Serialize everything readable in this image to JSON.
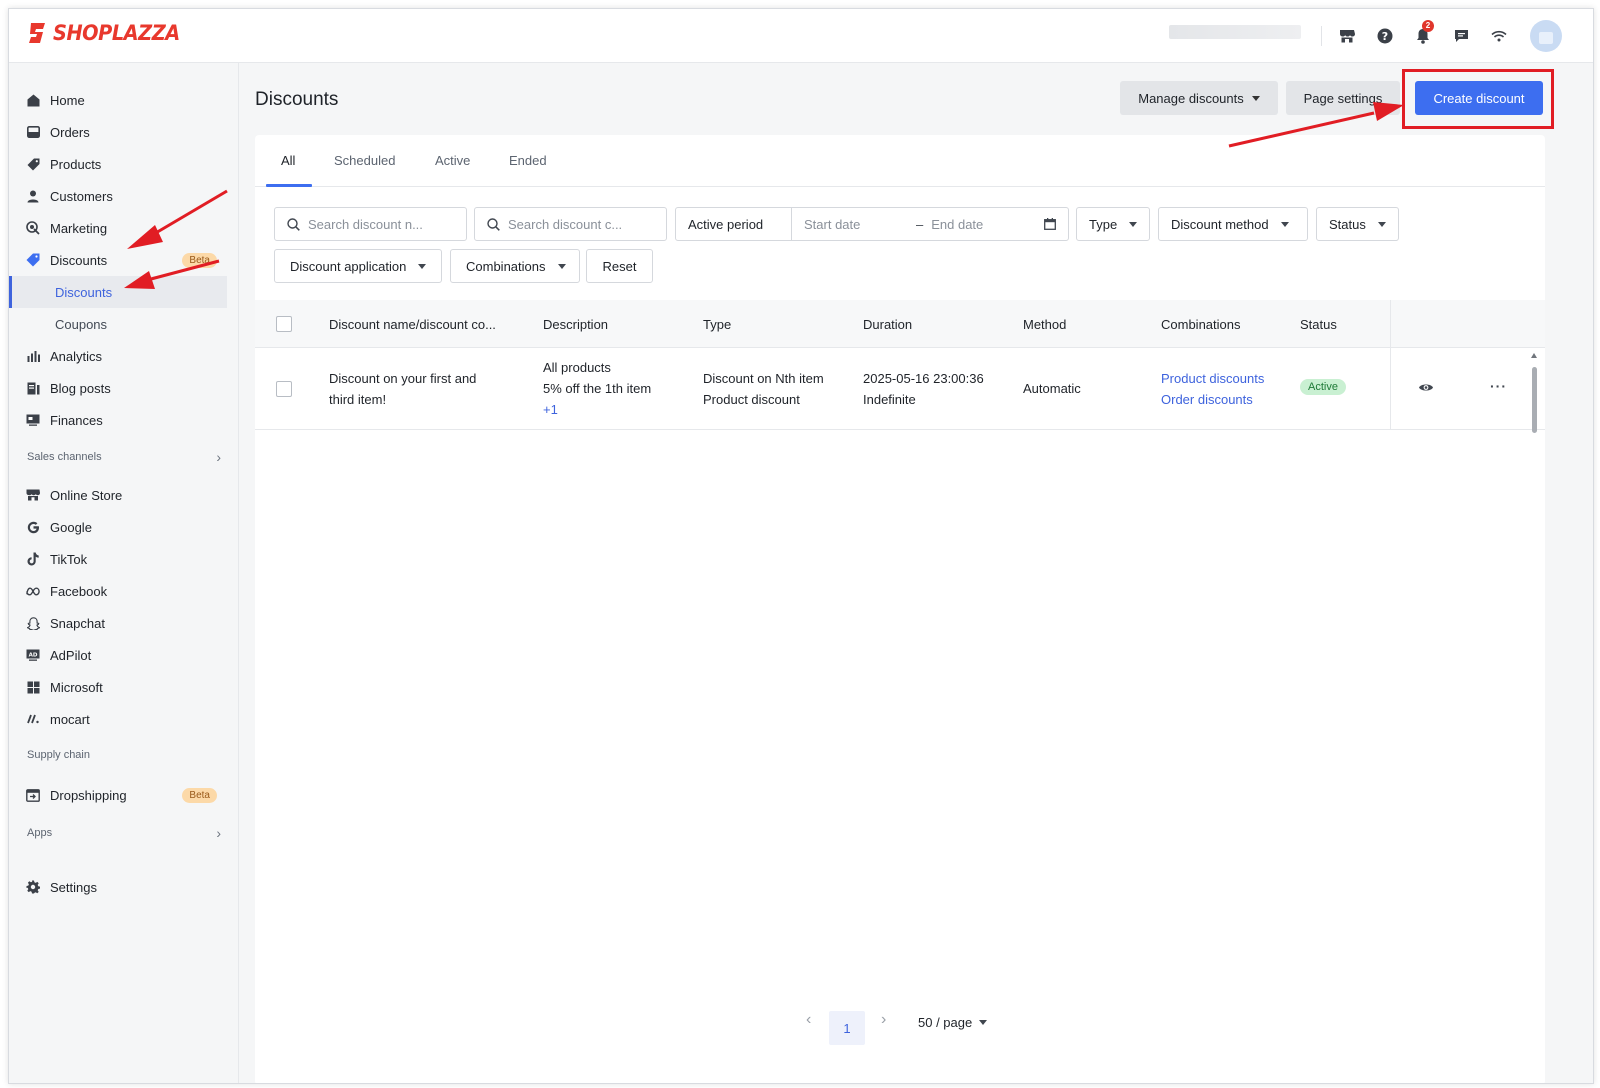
{
  "brand": {
    "name": "SHOPLAZZA",
    "color": "#e8382d"
  },
  "topbar": {
    "icons": [
      "storefront-icon",
      "help-icon",
      "bell-icon",
      "chat-icon",
      "wifi-icon"
    ],
    "notification_count": "2"
  },
  "sidebar": {
    "items": [
      {
        "label": "Home",
        "icon": "home-icon"
      },
      {
        "label": "Orders",
        "icon": "orders-icon"
      },
      {
        "label": "Products",
        "icon": "tag-icon"
      },
      {
        "label": "Customers",
        "icon": "person-icon"
      },
      {
        "label": "Marketing",
        "icon": "marketing-icon"
      },
      {
        "label": "Discounts",
        "icon": "discount-icon",
        "badge": "Beta"
      }
    ],
    "sub_items": [
      {
        "label": "Discounts",
        "active": true
      },
      {
        "label": "Coupons",
        "active": false
      }
    ],
    "items2": [
      {
        "label": "Analytics",
        "icon": "analytics-icon"
      },
      {
        "label": "Blog posts",
        "icon": "blog-icon"
      },
      {
        "label": "Finances",
        "icon": "finance-icon"
      }
    ],
    "sales_channels_label": "Sales channels",
    "channels": [
      {
        "label": "Online Store",
        "icon": "store-icon"
      },
      {
        "label": "Google",
        "icon": "google-icon"
      },
      {
        "label": "TikTok",
        "icon": "tiktok-icon"
      },
      {
        "label": "Facebook",
        "icon": "meta-icon"
      },
      {
        "label": "Snapchat",
        "icon": "snapchat-icon"
      },
      {
        "label": "AdPilot",
        "icon": "adpilot-icon"
      },
      {
        "label": "Microsoft",
        "icon": "microsoft-icon"
      },
      {
        "label": "mocart",
        "icon": "mocart-icon"
      }
    ],
    "supply_chain_label": "Supply chain",
    "dropshipping": {
      "label": "Dropshipping",
      "badge": "Beta",
      "icon": "dropshipping-icon"
    },
    "apps_label": "Apps",
    "settings_label": "Settings"
  },
  "header": {
    "title": "Discounts",
    "manage_label": "Manage discounts",
    "page_settings_label": "Page settings",
    "create_label": "Create discount"
  },
  "tabs": [
    "All",
    "Scheduled",
    "Active",
    "Ended"
  ],
  "filters": {
    "search_name_placeholder": "Search discount n...",
    "search_code_placeholder": "Search discount c...",
    "active_period_label": "Active period",
    "start_date_placeholder": "Start date",
    "end_date_placeholder": "End date",
    "type_label": "Type",
    "method_label": "Discount method",
    "status_label": "Status",
    "application_label": "Discount application",
    "combinations_label": "Combinations",
    "reset_label": "Reset"
  },
  "table": {
    "headers": [
      "Discount name/discount co...",
      "Description",
      "Type",
      "Duration",
      "Method",
      "Combinations",
      "Status"
    ],
    "rows": [
      {
        "name_line1": "Discount on your first and",
        "name_line2": "third item!",
        "desc_line1": "All products",
        "desc_line2": "5% off the 1th item",
        "desc_more": "+1",
        "type_line1": "Discount on Nth item",
        "type_line2": "Product discount",
        "duration_start": "2025-05-16 23:00:36",
        "duration_end": "Indefinite",
        "method": "Automatic",
        "combo1": "Product discounts",
        "combo2": "Order discounts",
        "status": "Active"
      }
    ]
  },
  "pagination": {
    "current": "1",
    "per_page": "50 / page"
  },
  "colors": {
    "primary": "#3d6ef0",
    "annotation_red": "#e11d24",
    "active_green": "#c9f0d2"
  }
}
